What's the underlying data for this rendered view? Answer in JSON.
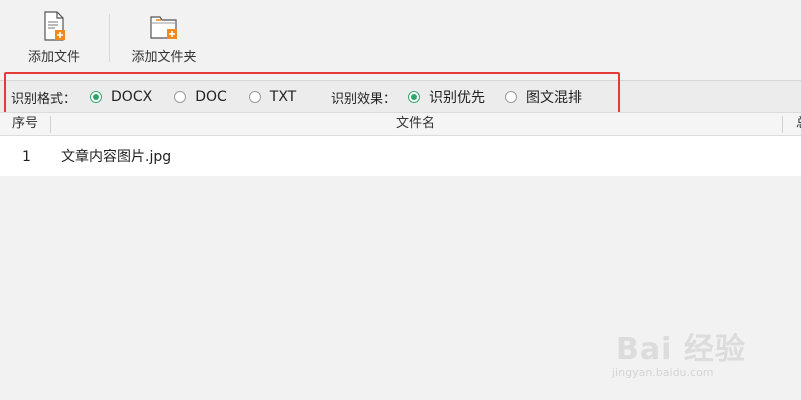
{
  "toolbar": {
    "add_file_label": "添加文件",
    "add_folder_label": "添加文件夹",
    "accent_color": "#f08a1c"
  },
  "options": {
    "format_label": "识别格式：",
    "formats": [
      {
        "label": "DOCX",
        "checked": true
      },
      {
        "label": "DOC",
        "checked": false
      },
      {
        "label": "TXT",
        "checked": false
      }
    ],
    "effect_label": "识别效果：",
    "effects": [
      {
        "label": "识别优先",
        "checked": true
      },
      {
        "label": "图文混排",
        "checked": false
      }
    ],
    "selected_color": "#2fa56c",
    "highlight_color": "#e53a3a"
  },
  "table": {
    "headers": {
      "index": "序号",
      "filename": "文件名",
      "more": "总"
    },
    "rows": [
      {
        "index": "1",
        "filename": "文章内容图片.jpg"
      }
    ]
  },
  "watermark": {
    "brand": "Bai 经验",
    "domain": "jingyan.baidu.com"
  }
}
